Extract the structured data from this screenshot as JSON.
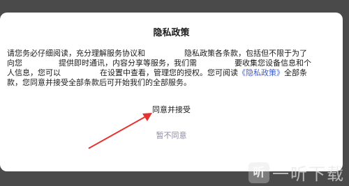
{
  "dialog": {
    "title": "隐私政策",
    "body": {
      "line1a": "请您务必仔细阅读，充分理解服务协议和",
      "line1b": "隐私政策各条款，包括但不限于为了",
      "line2a": "向您",
      "line2b": "提供即时通讯，内容分享等服务，我们需",
      "line2c": "要收集您设备信息和个",
      "line3a": "人信息，您可以",
      "line3b": "在设置中查看，管理您的授权。您可阅读",
      "line3link": "《隐私政策》",
      "line3c": "全部条",
      "line4": "款，您同意并接受全部条款后可开始我们的全部服务。"
    },
    "agree_label": "同意并接受",
    "disagree_label": "暂不同意"
  },
  "watermark": {
    "logo": "听",
    "text": "一听下载"
  },
  "colors": {
    "link": "#3d5ccc",
    "arrow": "#e3342f",
    "disagree": "#8a8aa6"
  }
}
